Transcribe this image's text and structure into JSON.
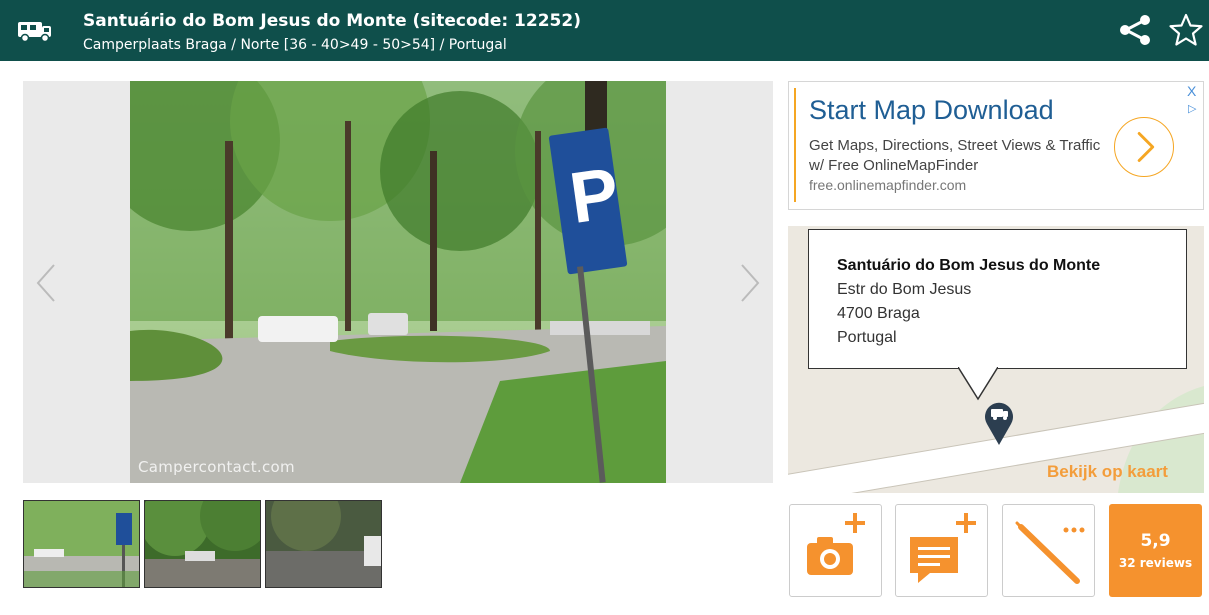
{
  "header": {
    "title": "Santuário do Bom Jesus do Monte (sitecode: 12252)",
    "subtitle": "Camperplaats Braga / Norte [36 - 40>49 - 50>54] / Portugal",
    "logo_icon": "camper-icon",
    "share_icon": "share-icon",
    "favorite_icon": "star-outline-icon"
  },
  "gallery": {
    "watermark": "Campercontact.com",
    "prev_icon": "chevron-left-icon",
    "next_icon": "chevron-right-icon"
  },
  "ad": {
    "headline": "Start Map Download",
    "body": "Get Maps, Directions, Street Views & Traffic w/ Free OnlineMapFinder",
    "url": "free.onlinemapfinder.com",
    "close": "X",
    "adchoices_icon": "adchoices-icon",
    "go_icon": "chevron-right-icon"
  },
  "map": {
    "place_name": "Santuário do Bom Jesus do Monte",
    "street": "Estr do Bom Jesus",
    "city": "4700 Braga",
    "country": "Portugal",
    "view_map_label": "Bekijk op kaart",
    "marker_icon": "camper-marker-icon"
  },
  "actions": {
    "add_photo_icon": "camera-plus-icon",
    "add_review_icon": "comment-plus-icon",
    "edit_icon": "pen-icon"
  },
  "rating": {
    "score": "5,9",
    "reviews": "32 reviews"
  },
  "colors": {
    "header_bg": "#0f4f4b",
    "accent": "#f5922e",
    "ad_link": "#1f5e94"
  }
}
